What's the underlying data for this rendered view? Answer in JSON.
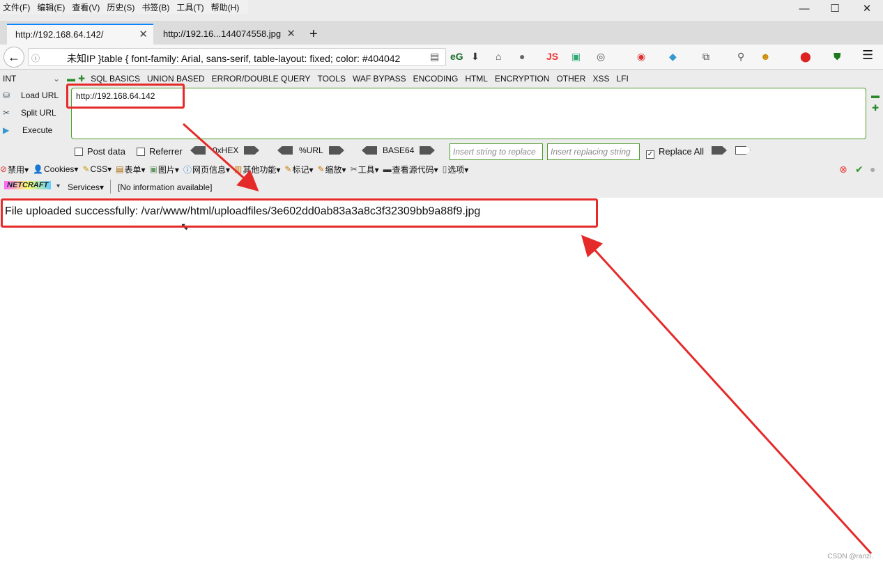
{
  "menubar": {
    "items": [
      "文件(F)",
      "编辑(E)",
      "查看(V)",
      "历史(S)",
      "书签(B)",
      "工具(T)",
      "帮助(H)"
    ]
  },
  "window": {
    "minimize": "—",
    "maximize": "☐",
    "close": "✕"
  },
  "tabs": [
    {
      "title": "http://192.168.64.142/",
      "close": "✕"
    },
    {
      "title": "http://192.16...144074558.jpg",
      "close": "✕"
    }
  ],
  "new_tab": "+",
  "navbar": {
    "back": "←",
    "info": "ⓘ",
    "url_text": "未知IP   }table { font-family: Arial, sans-serif, table-layout: fixed; color: #404042",
    "menu": "☰"
  },
  "hackbar": {
    "select_value": "INT",
    "menus": [
      "SQL BASICS",
      "UNION BASED",
      "ERROR/DOUBLE QUERY",
      "TOOLS",
      "WAF BYPASS",
      "ENCODING",
      "HTML",
      "ENCRYPTION",
      "OTHER",
      "XSS",
      "LFI"
    ],
    "load_url": "Load URL",
    "split_url": "Split URL",
    "execute": "Execute",
    "url_value": "http://192.168.64.142",
    "post_data": "Post data",
    "referrer": "Referrer",
    "hex": "0xHEX",
    "url_enc": "%URL",
    "base64": "BASE64",
    "replace_placeholder": "Insert string to replace",
    "replacing_placeholder": "Insert replacing string",
    "replace_all": "Replace All"
  },
  "toolbar2": [
    "禁用▾",
    "Cookies▾",
    "CSS▾",
    "表单▾",
    "图片▾",
    "网页信息▾",
    "其他功能▾",
    "标记▾",
    "缩放▾",
    "工具▾",
    "查看源代码▾",
    "选项▾"
  ],
  "netcraft": {
    "logo": "NETCRAFT",
    "services": "Services▾",
    "info": "[No information available]"
  },
  "content": {
    "message": "File uploaded successfully: /var/www/html/uploadfiles/3e602dd0ab83a3a8c3f32309bb9a88f9.jpg"
  },
  "watermark": "CSDN @ranzi."
}
